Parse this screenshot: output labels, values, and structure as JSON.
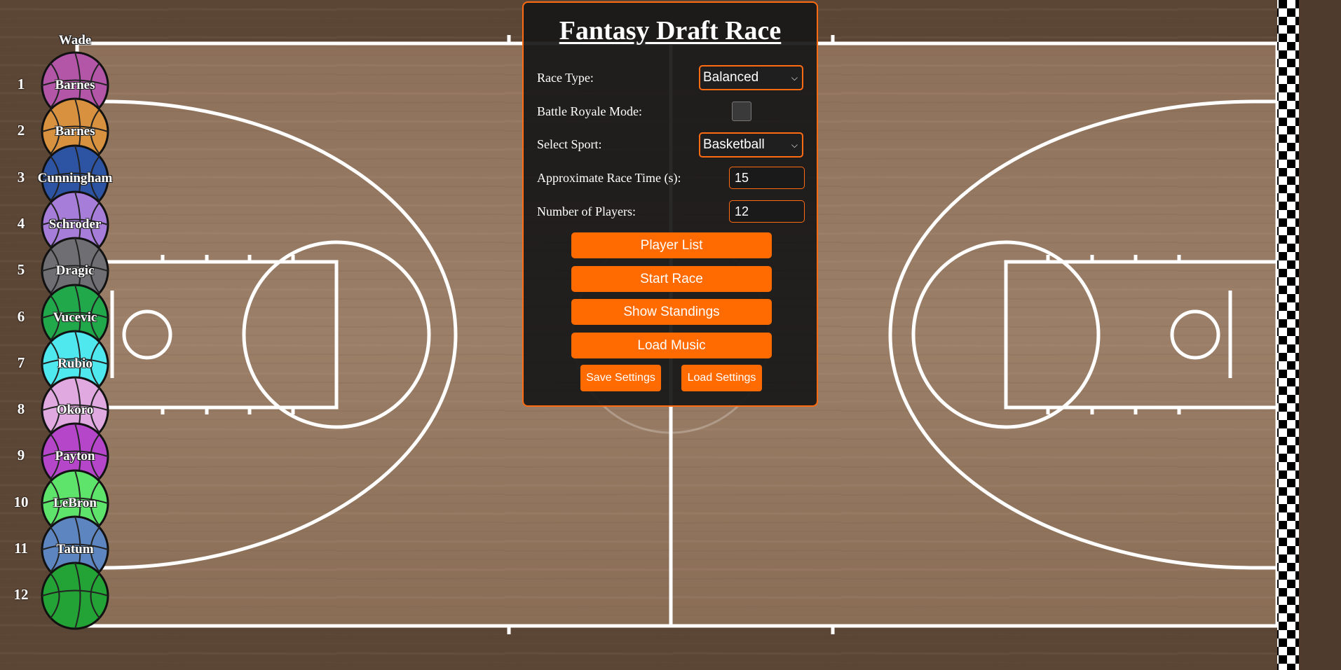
{
  "panel": {
    "title": "Fantasy Draft Race",
    "race_type_label": "Race Type:",
    "race_type_value": "Balanced",
    "battle_royale_label": "Battle Royale Mode:",
    "battle_royale_checked": false,
    "sport_label": "Select Sport:",
    "sport_value": "Basketball",
    "race_time_label": "Approximate Race Time (s):",
    "race_time_value": "15",
    "num_players_label": "Number of Players:",
    "num_players_value": "12",
    "buttons": {
      "player_list": "Player List",
      "start_race": "Start Race",
      "show_standings": "Show Standings",
      "load_music": "Load Music",
      "save_settings": "Save Settings",
      "load_settings": "Load Settings"
    },
    "accent_color": "#ff6b00"
  },
  "racers": [
    {
      "lane": "1",
      "name": "Barnes",
      "color": "#b356a8"
    },
    {
      "lane": "2",
      "name": "Barnes",
      "color": "#d8913e"
    },
    {
      "lane": "3",
      "name": "Cunningham",
      "color": "#2d53a3"
    },
    {
      "lane": "4",
      "name": "Schroder",
      "color": "#a67dd8"
    },
    {
      "lane": "5",
      "name": "Dragic",
      "color": "#6f6e72"
    },
    {
      "lane": "6",
      "name": "Vucevic",
      "color": "#21a84a"
    },
    {
      "lane": "7",
      "name": "Rubio",
      "color": "#4ee8ee"
    },
    {
      "lane": "8",
      "name": "Okoro",
      "color": "#e0a9e0"
    },
    {
      "lane": "9",
      "name": "Payton",
      "color": "#b546c9"
    },
    {
      "lane": "10",
      "name": "LeBron",
      "color": "#5ee36b"
    },
    {
      "lane": "11",
      "name": "Tatum",
      "color": "#5d85c0"
    },
    {
      "lane": "12",
      "name": "",
      "color": "#23a335"
    }
  ],
  "top_partial_name": "Wade",
  "finish_line": "checkered"
}
